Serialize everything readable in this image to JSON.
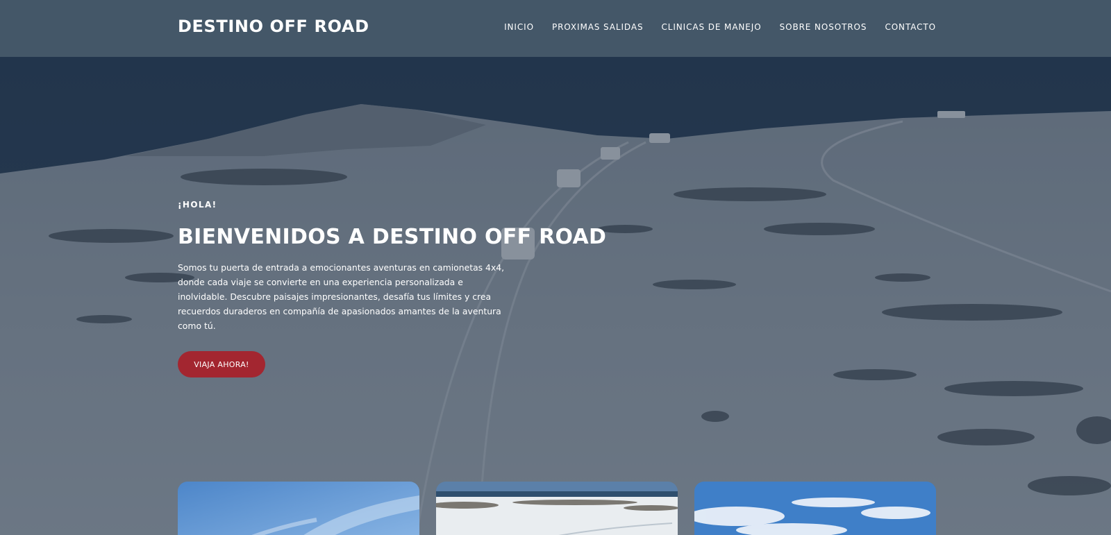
{
  "header": {
    "brand": "DESTINO OFF ROAD",
    "nav": [
      {
        "label": "INICIO"
      },
      {
        "label": "PROXIMAS SALIDAS"
      },
      {
        "label": "CLINICAS DE MANEJO"
      },
      {
        "label": "SOBRE NOSOTROS"
      },
      {
        "label": "CONTACTO"
      }
    ]
  },
  "hero": {
    "kicker": "¡HOLA!",
    "title": "BIENVENIDOS A DESTINO OFF ROAD",
    "text": "Somos tu puerta de entrada a emocionantes aventuras en camionetas 4x4, donde cada viaje se convierte en una experiencia personalizada e inolvidable. Descubre paisajes impresionantes, desafía tus límites y crea recuerdos duraderos en compañía de apasionados amantes de la aventura como tú.",
    "cta_label": "VIAJA AHORA!"
  },
  "colors": {
    "header_bg": "#485a6a",
    "cta": "#a32630",
    "text": "#ffffff"
  }
}
